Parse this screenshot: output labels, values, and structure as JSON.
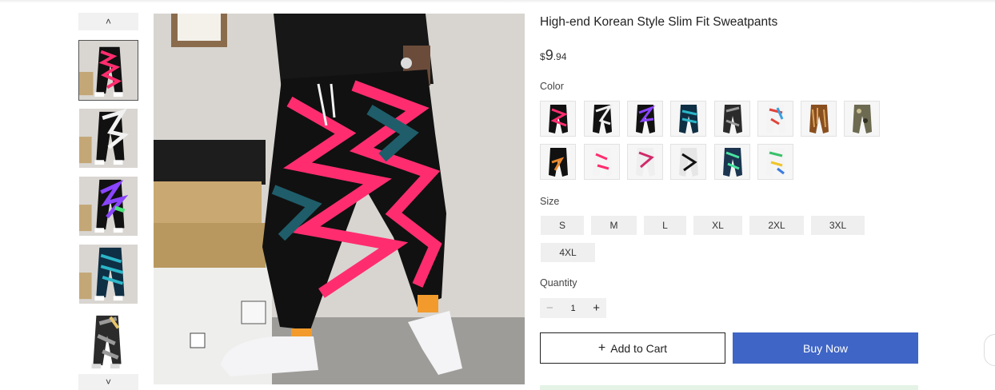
{
  "product": {
    "title": "High-end Korean Style Slim Fit Sweatpants",
    "price_currency": "$",
    "price_integer": "9",
    "price_decimal": ".94"
  },
  "gallery": {
    "prev_icon": "chevron-up-icon",
    "next_icon": "chevron-down-icon",
    "prev_glyph": "˄",
    "next_glyph": "˅",
    "thumbnail_count": 5
  },
  "options": {
    "color_label": "Color",
    "color_swatch_count": 14,
    "size_label": "Size",
    "sizes": [
      "S",
      "M",
      "L",
      "XL",
      "2XL",
      "3XL",
      "4XL"
    ],
    "quantity_label": "Quantity",
    "quantity_value": "1",
    "minus_glyph": "−",
    "plus_glyph": "+"
  },
  "actions": {
    "add_to_cart_icon": "plus-icon",
    "add_to_cart_glyph": "+",
    "add_to_cart_label": "Add to Cart",
    "buy_now_label": "Buy Now"
  },
  "colors": {
    "buy_now_bg": "#3f65c6",
    "pattern_pink": "#ff2d6f",
    "pattern_black": "#111111",
    "pattern_teal": "#1f5d6a"
  }
}
